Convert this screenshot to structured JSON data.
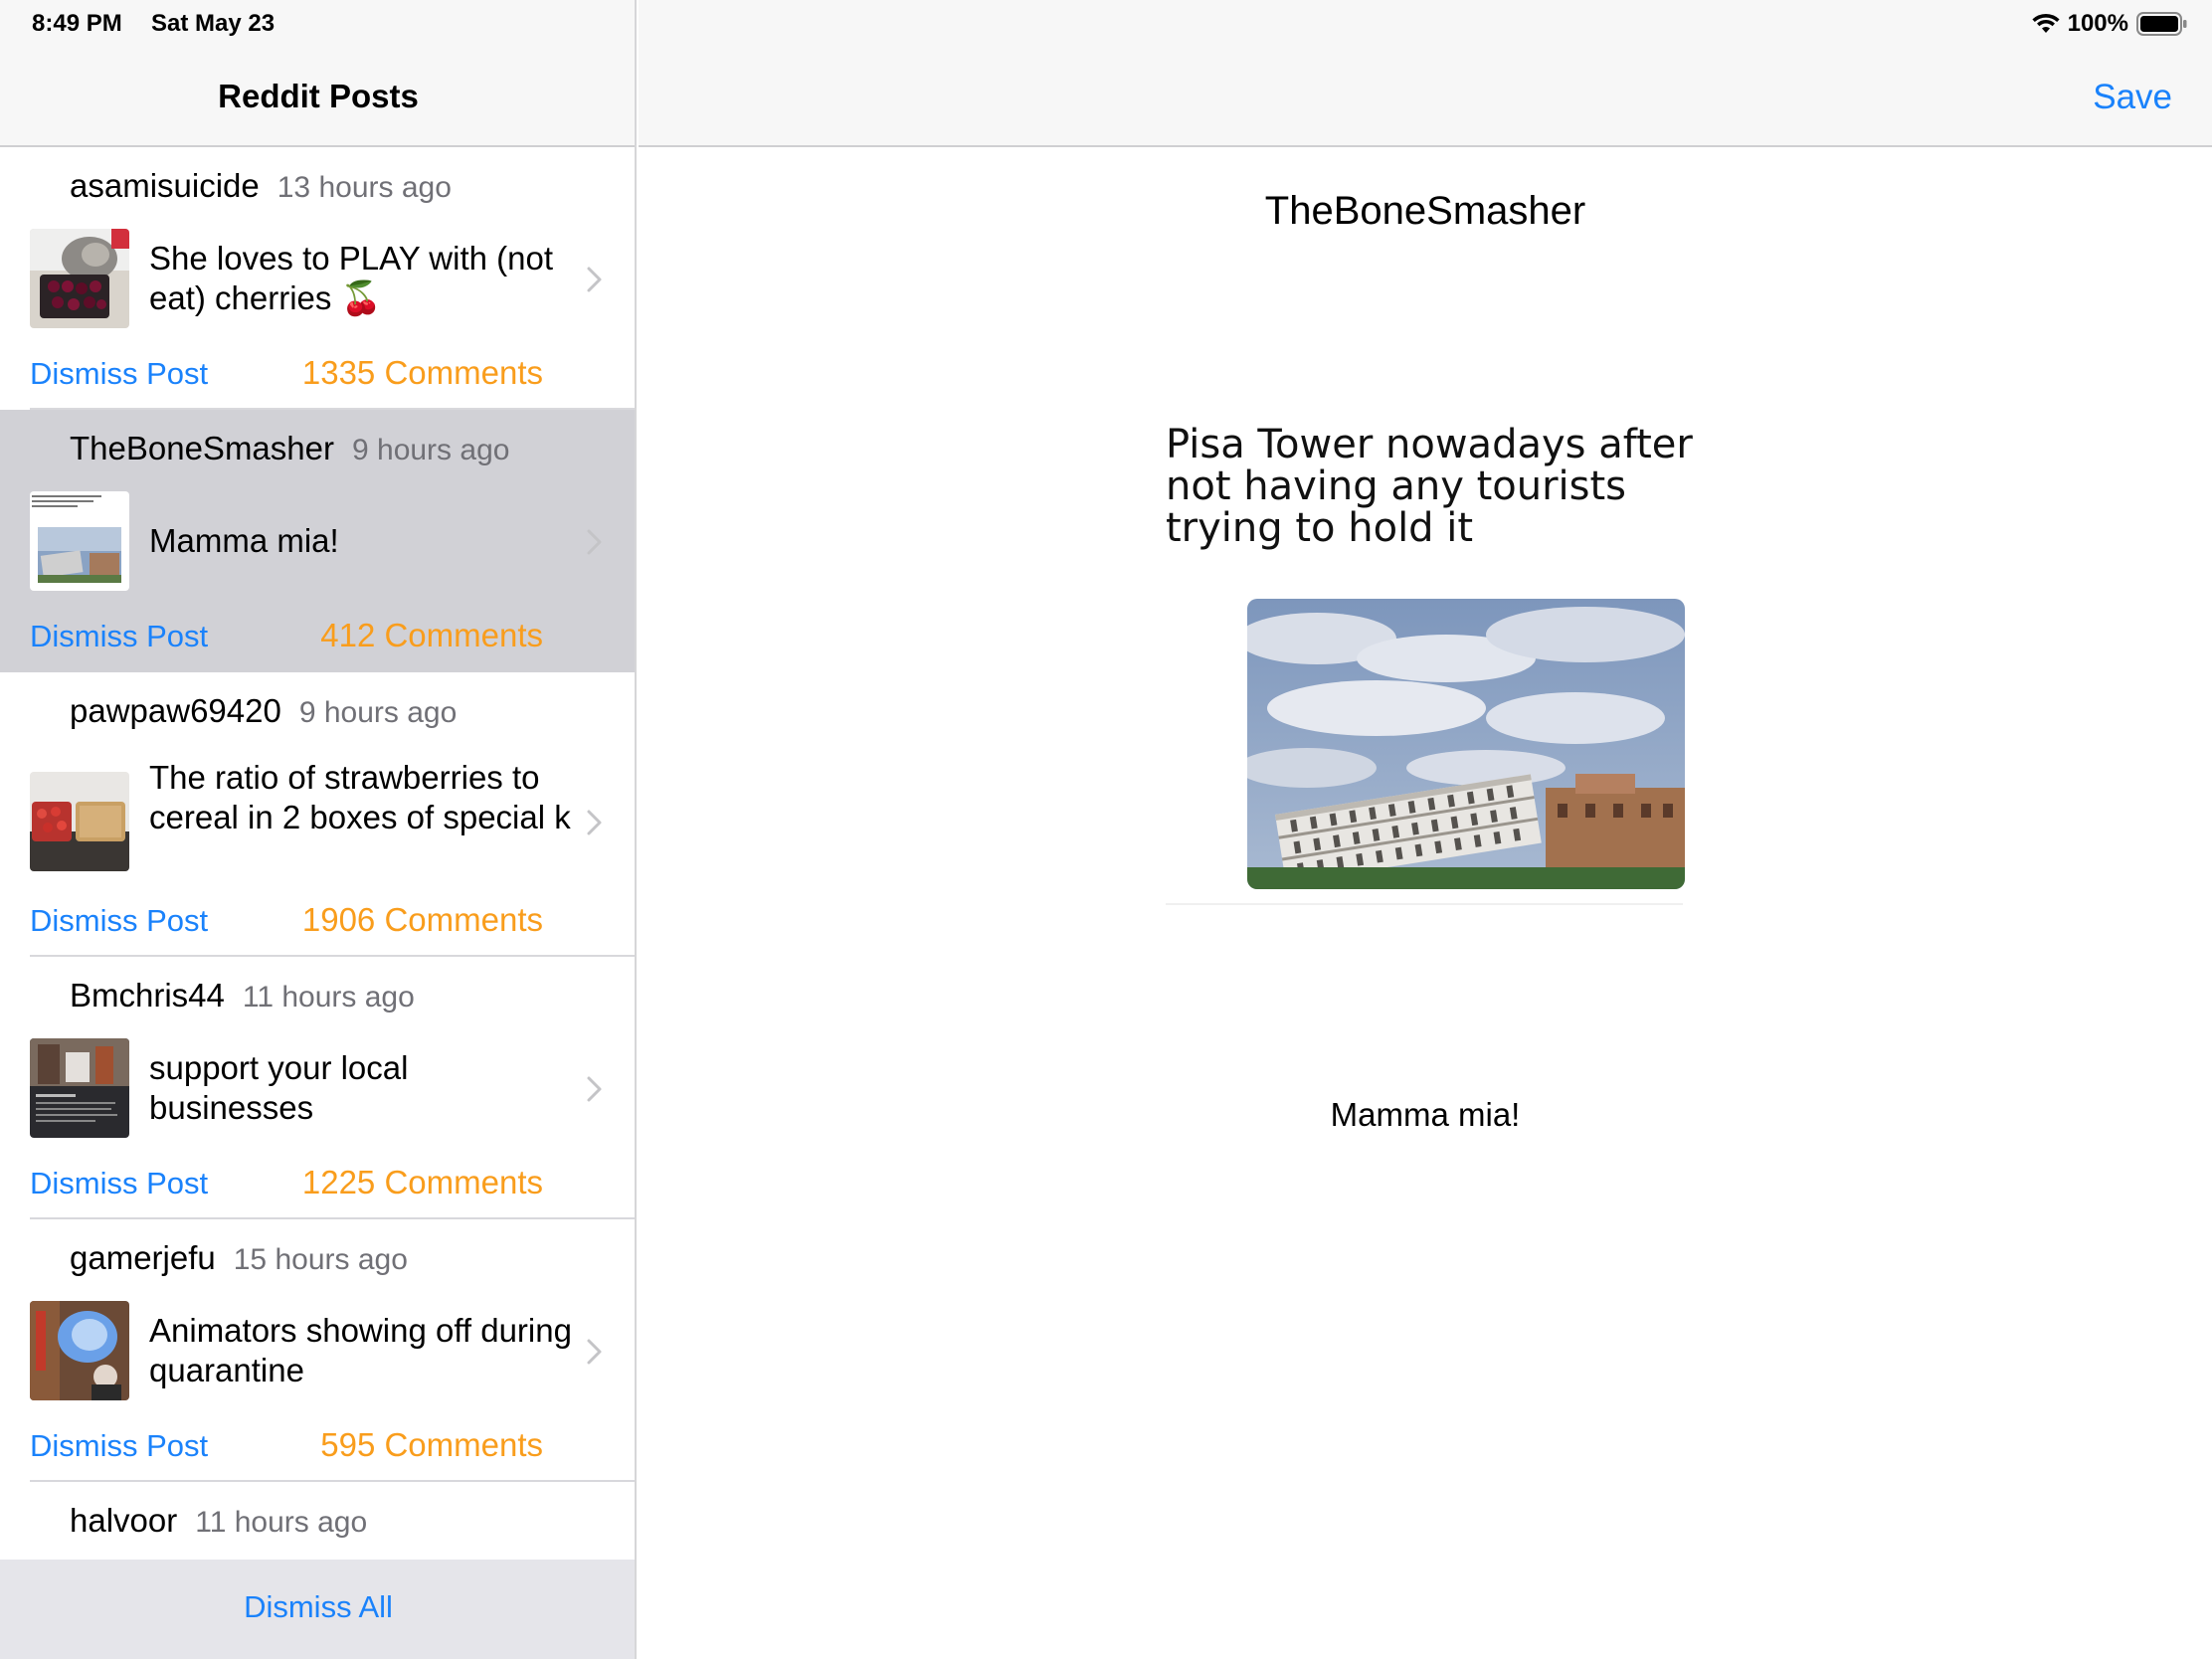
{
  "status": {
    "time": "8:49 PM",
    "date": "Sat May 23",
    "battery": "100%"
  },
  "sidebar": {
    "title": "Reddit Posts",
    "dismiss_all": "Dismiss All",
    "posts": [
      {
        "author": "asamisuicide",
        "time": "13 hours ago",
        "title": "She loves to PLAY with (not eat) cherries 🍒",
        "dismiss": "Dismiss Post",
        "comments": "1335 Comments"
      },
      {
        "author": "TheBoneSmasher",
        "time": "9 hours ago",
        "title": "Mamma mia!",
        "dismiss": "Dismiss Post",
        "comments": "412 Comments"
      },
      {
        "author": "pawpaw69420",
        "time": "9 hours ago",
        "title": "The ratio of strawberries to cereal in 2 boxes of special k",
        "dismiss": "Dismiss Post",
        "comments": "1906 Comments"
      },
      {
        "author": "Bmchris44",
        "time": "11 hours ago",
        "title": "support your local businesses",
        "dismiss": "Dismiss Post",
        "comments": "1225 Comments"
      },
      {
        "author": "gamerjefu",
        "time": "15 hours ago",
        "title": "Animators showing off during quarantine",
        "dismiss": "Dismiss Post",
        "comments": "595 Comments"
      },
      {
        "author": "halvoor",
        "time": "11 hours ago"
      }
    ]
  },
  "detail": {
    "save": "Save",
    "author": "TheBoneSmasher",
    "caption_lines": [
      "Pisa Tower nowadays after",
      "not having any tourists",
      "trying to hold it"
    ],
    "title": "Mamma mia!"
  },
  "colors": {
    "accent": "#1a82fb",
    "comments": "#f99d1c",
    "selected_row": "#d1d1d6",
    "toolbar": "#e5e5ea"
  }
}
